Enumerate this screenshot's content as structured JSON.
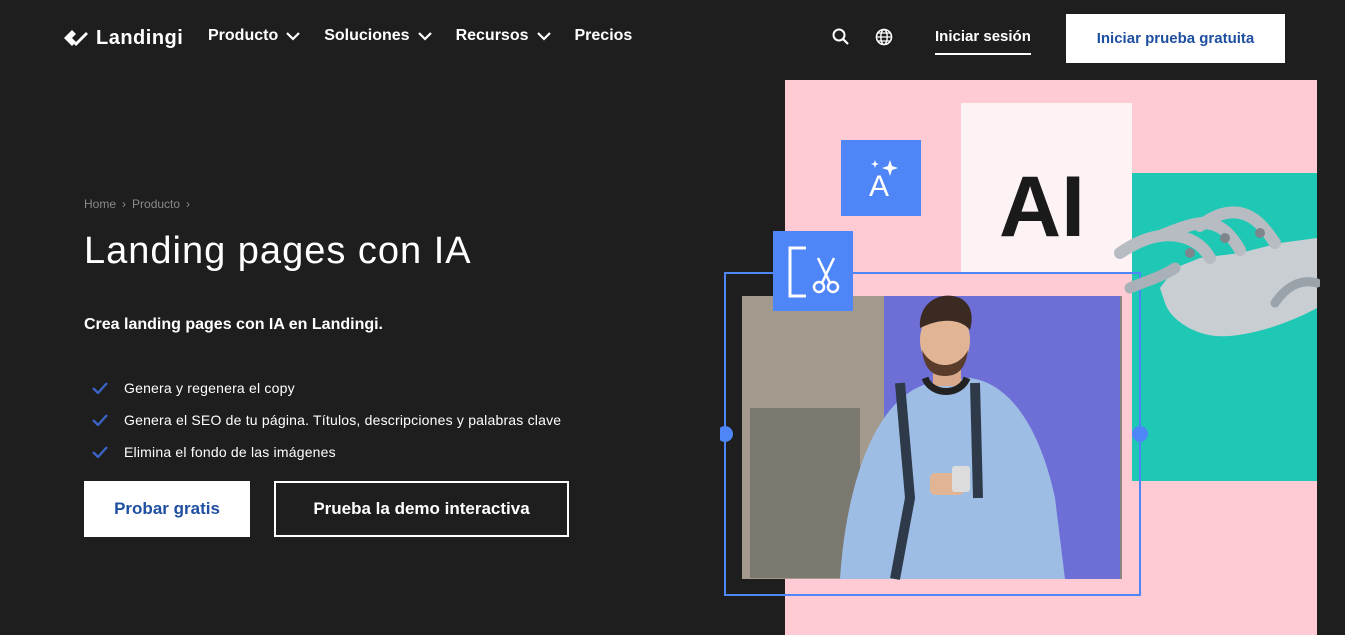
{
  "brand": {
    "name": "Landingi"
  },
  "nav": {
    "items": [
      {
        "label": "Producto",
        "has_dropdown": true
      },
      {
        "label": "Soluciones",
        "has_dropdown": true
      },
      {
        "label": "Recursos",
        "has_dropdown": true
      },
      {
        "label": "Precios",
        "has_dropdown": false
      }
    ],
    "search_icon": "search-icon",
    "language_icon": "globe-icon",
    "login_label": "Iniciar sesión",
    "trial_label": "Iniciar prueba gratuita"
  },
  "breadcrumb": [
    "Home",
    "Producto"
  ],
  "hero": {
    "title": "Landing pages con IA",
    "subtitle": "Crea landing pages con IA en Landingi.",
    "features": [
      "Genera y regenera el copy",
      "Genera el SEO de tu página. Títulos, descripciones y palabras clave",
      "Elimina el fondo de las imágenes"
    ],
    "primary_cta": "Probar gratis",
    "secondary_cta": "Prueba la demo interactiva"
  },
  "illustration": {
    "ai_text": "AI",
    "colors": {
      "pink": "#fecad3",
      "teal": "#1ec8b4",
      "purple": "#6d6fd6",
      "blue": "#4f86f7",
      "accent_blue": "#1f4fa0",
      "check": "#3b63c4"
    }
  }
}
